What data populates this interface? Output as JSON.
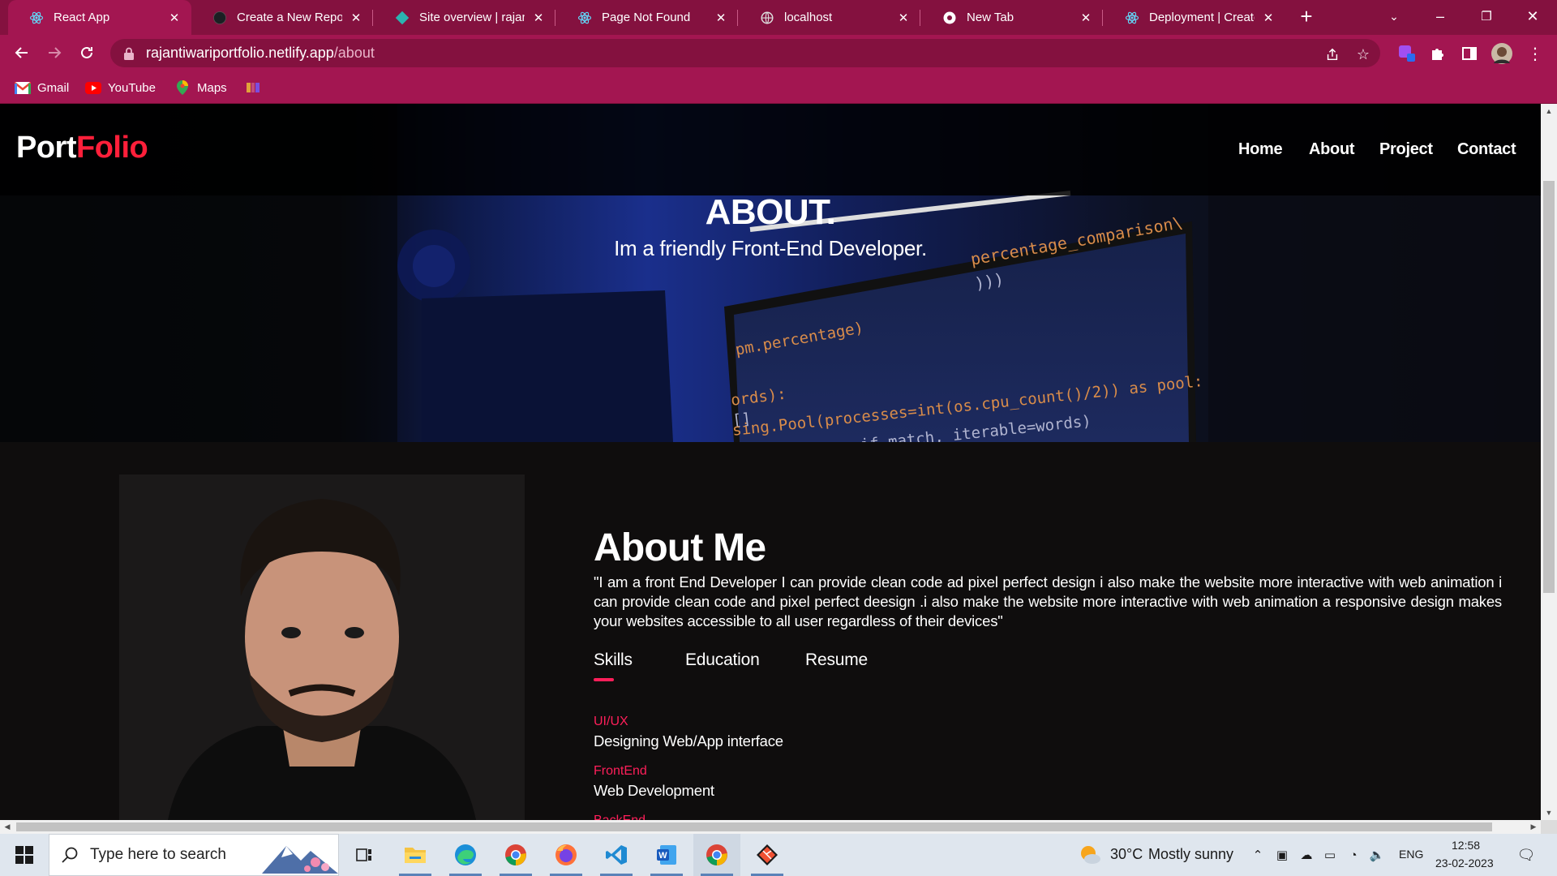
{
  "browser": {
    "tabs": [
      {
        "title": "React App",
        "icon": "react-icon",
        "active": true
      },
      {
        "title": "Create a New Reposit",
        "icon": "github-icon",
        "active": false
      },
      {
        "title": "Site overview | rajanti",
        "icon": "netlify-icon",
        "active": false
      },
      {
        "title": "Page Not Found",
        "icon": "react-icon",
        "active": false
      },
      {
        "title": "localhost",
        "icon": "globe-icon",
        "active": false
      },
      {
        "title": "New Tab",
        "icon": "chrome-icon",
        "active": false
      },
      {
        "title": "Deployment | Create",
        "icon": "react-icon",
        "active": false
      }
    ],
    "url_host": "rajantiwariportfolio.netlify.app",
    "url_path": "/about",
    "bookmarks": [
      {
        "label": "Gmail",
        "icon": "gmail-icon"
      },
      {
        "label": "YouTube",
        "icon": "youtube-icon"
      },
      {
        "label": "Maps",
        "icon": "maps-icon"
      },
      {
        "label": "",
        "icon": "bookmark-favicon"
      }
    ]
  },
  "site": {
    "logo_part1": "Port",
    "logo_part2": "Folio",
    "nav": [
      "Home",
      "About",
      "Project",
      "Contact"
    ],
    "hero_title": "ABOUT.",
    "hero_subtitle": "Im a friendly Front-End Developer.",
    "hero_code_lines": [
      "percentage_comparison\\",
      ")))",
      "pm.percentage)",
      "ords):",
      "[]",
      "sing.Pool(processes=int(os.cpu_count()/2)) as pool:",
      "if match, iterable=words)"
    ],
    "about_title": "About Me",
    "about_text": "\"I am a front End Developer I can provide clean code ad pixel perfect design i also make the website more interactive with web animation i can provide clean code and pixel perfect deesign .i also make the website more interactive with web animation a responsive design makes your websites accessible to all user regardless of their devices\"",
    "tabs": [
      "Skills",
      "Education",
      "Resume"
    ],
    "active_tab": "Skills",
    "skills": [
      {
        "category": "UI/UX",
        "description": "Designing Web/App interface"
      },
      {
        "category": "FrontEnd",
        "description": "Web Development"
      },
      {
        "category": "BackEnd",
        "description": ""
      }
    ],
    "accent_color": "#ff1f3a"
  },
  "taskbar": {
    "search_placeholder": "Type here to search",
    "weather_temp": "30°C",
    "weather_text": "Mostly sunny",
    "language": "ENG",
    "time": "12:58",
    "date": "23-02-2023",
    "apps": [
      "task-view-icon",
      "file-explorer-icon",
      "edge-icon",
      "chrome-icon",
      "firefox-icon",
      "vscode-icon",
      "word-icon",
      "chrome-active-icon",
      "git-icon"
    ]
  }
}
